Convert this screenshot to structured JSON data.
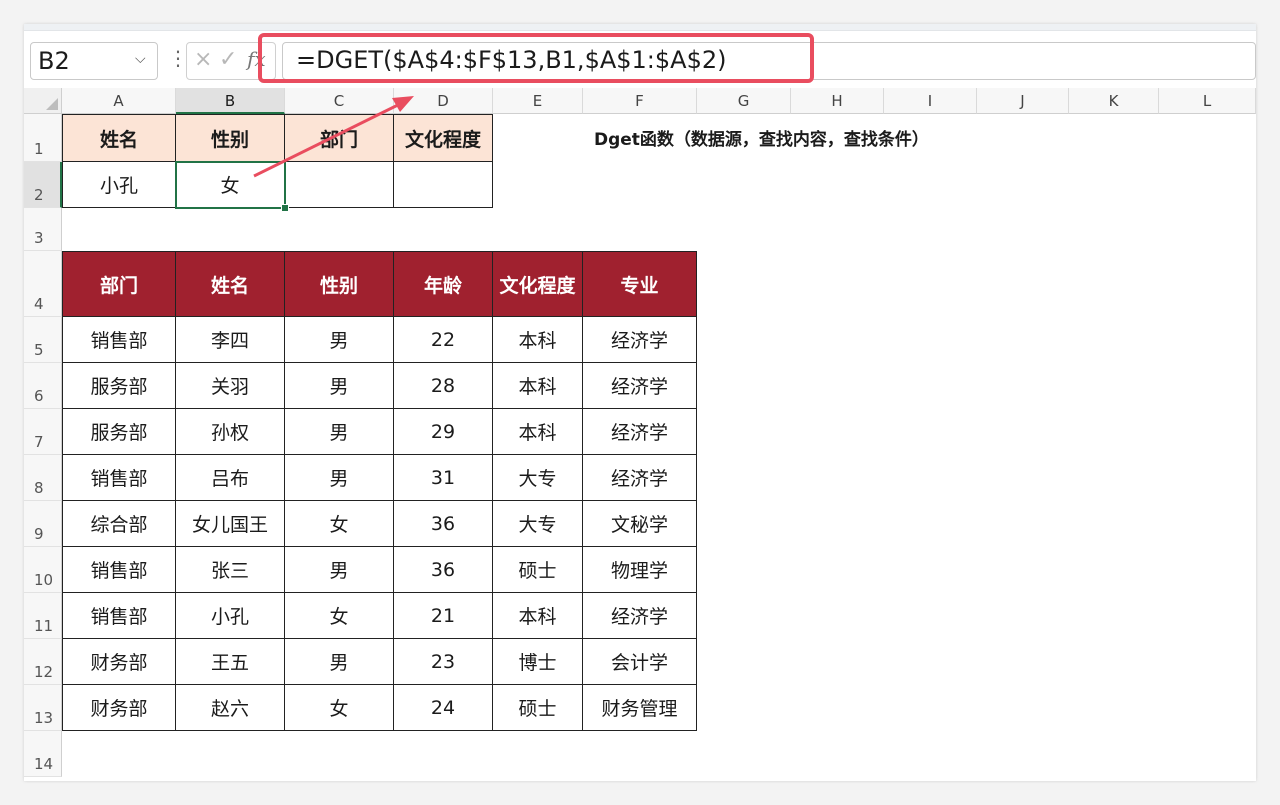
{
  "name_box": "B2",
  "formula": "=DGET($A$4:$F$13,B1,$A$1:$A$2)",
  "formula_buttons": {
    "cancel": "×",
    "enter": "✓",
    "fx": "fx"
  },
  "columns": [
    "A",
    "B",
    "C",
    "D",
    "E",
    "F",
    "G",
    "H",
    "I",
    "J",
    "K",
    "L"
  ],
  "rows": [
    "1",
    "2",
    "3",
    "4",
    "5",
    "6",
    "7",
    "8",
    "9",
    "10",
    "11",
    "12",
    "13",
    "14"
  ],
  "criteria": {
    "headers": [
      "姓名",
      "性别",
      "部门",
      "文化程度"
    ],
    "values": [
      "小孔",
      "女",
      "",
      ""
    ]
  },
  "title": "Dget函数（数据源，查找内容，查找条件）",
  "table": {
    "headers": [
      "部门",
      "姓名",
      "性别",
      "年龄",
      "文化程度",
      "专业"
    ],
    "rows": [
      [
        "销售部",
        "李四",
        "男",
        "22",
        "本科",
        "经济学"
      ],
      [
        "服务部",
        "关羽",
        "男",
        "28",
        "本科",
        "经济学"
      ],
      [
        "服务部",
        "孙权",
        "男",
        "29",
        "本科",
        "经济学"
      ],
      [
        "销售部",
        "吕布",
        "男",
        "31",
        "大专",
        "经济学"
      ],
      [
        "综合部",
        "女儿国王",
        "女",
        "36",
        "大专",
        "文秘学"
      ],
      [
        "销售部",
        "张三",
        "男",
        "36",
        "硕士",
        "物理学"
      ],
      [
        "销售部",
        "小孔",
        "女",
        "21",
        "本科",
        "经济学"
      ],
      [
        "财务部",
        "王五",
        "男",
        "23",
        "博士",
        "会计学"
      ],
      [
        "财务部",
        "赵六",
        "女",
        "24",
        "硕士",
        "财务管理"
      ]
    ]
  },
  "colors": {
    "header_fill": "#a0212f",
    "criteria_fill": "#fce4d6",
    "highlight": "#e94d5f",
    "selection": "#217346"
  }
}
